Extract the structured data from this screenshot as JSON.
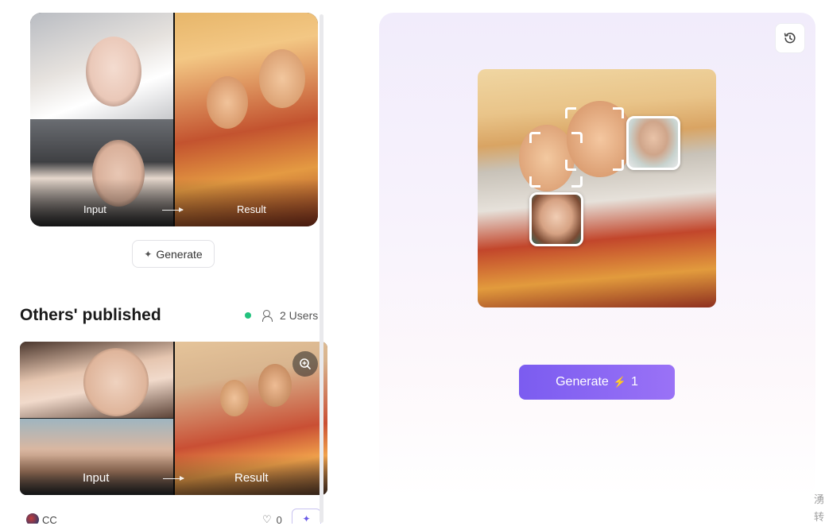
{
  "example": {
    "input_label": "Input",
    "result_label": "Result",
    "generate_label": "Generate"
  },
  "others": {
    "title": "Others' published",
    "status_color": "#22c27e",
    "users_label": "2 Users",
    "card": {
      "input_label": "Input",
      "result_label": "Result"
    },
    "author_name": "CC",
    "likes": "0"
  },
  "panel": {
    "generate_label": "Generate",
    "cost": "1",
    "accent": "#7b5cf0"
  },
  "side_chars": [
    "湧",
    "转"
  ]
}
